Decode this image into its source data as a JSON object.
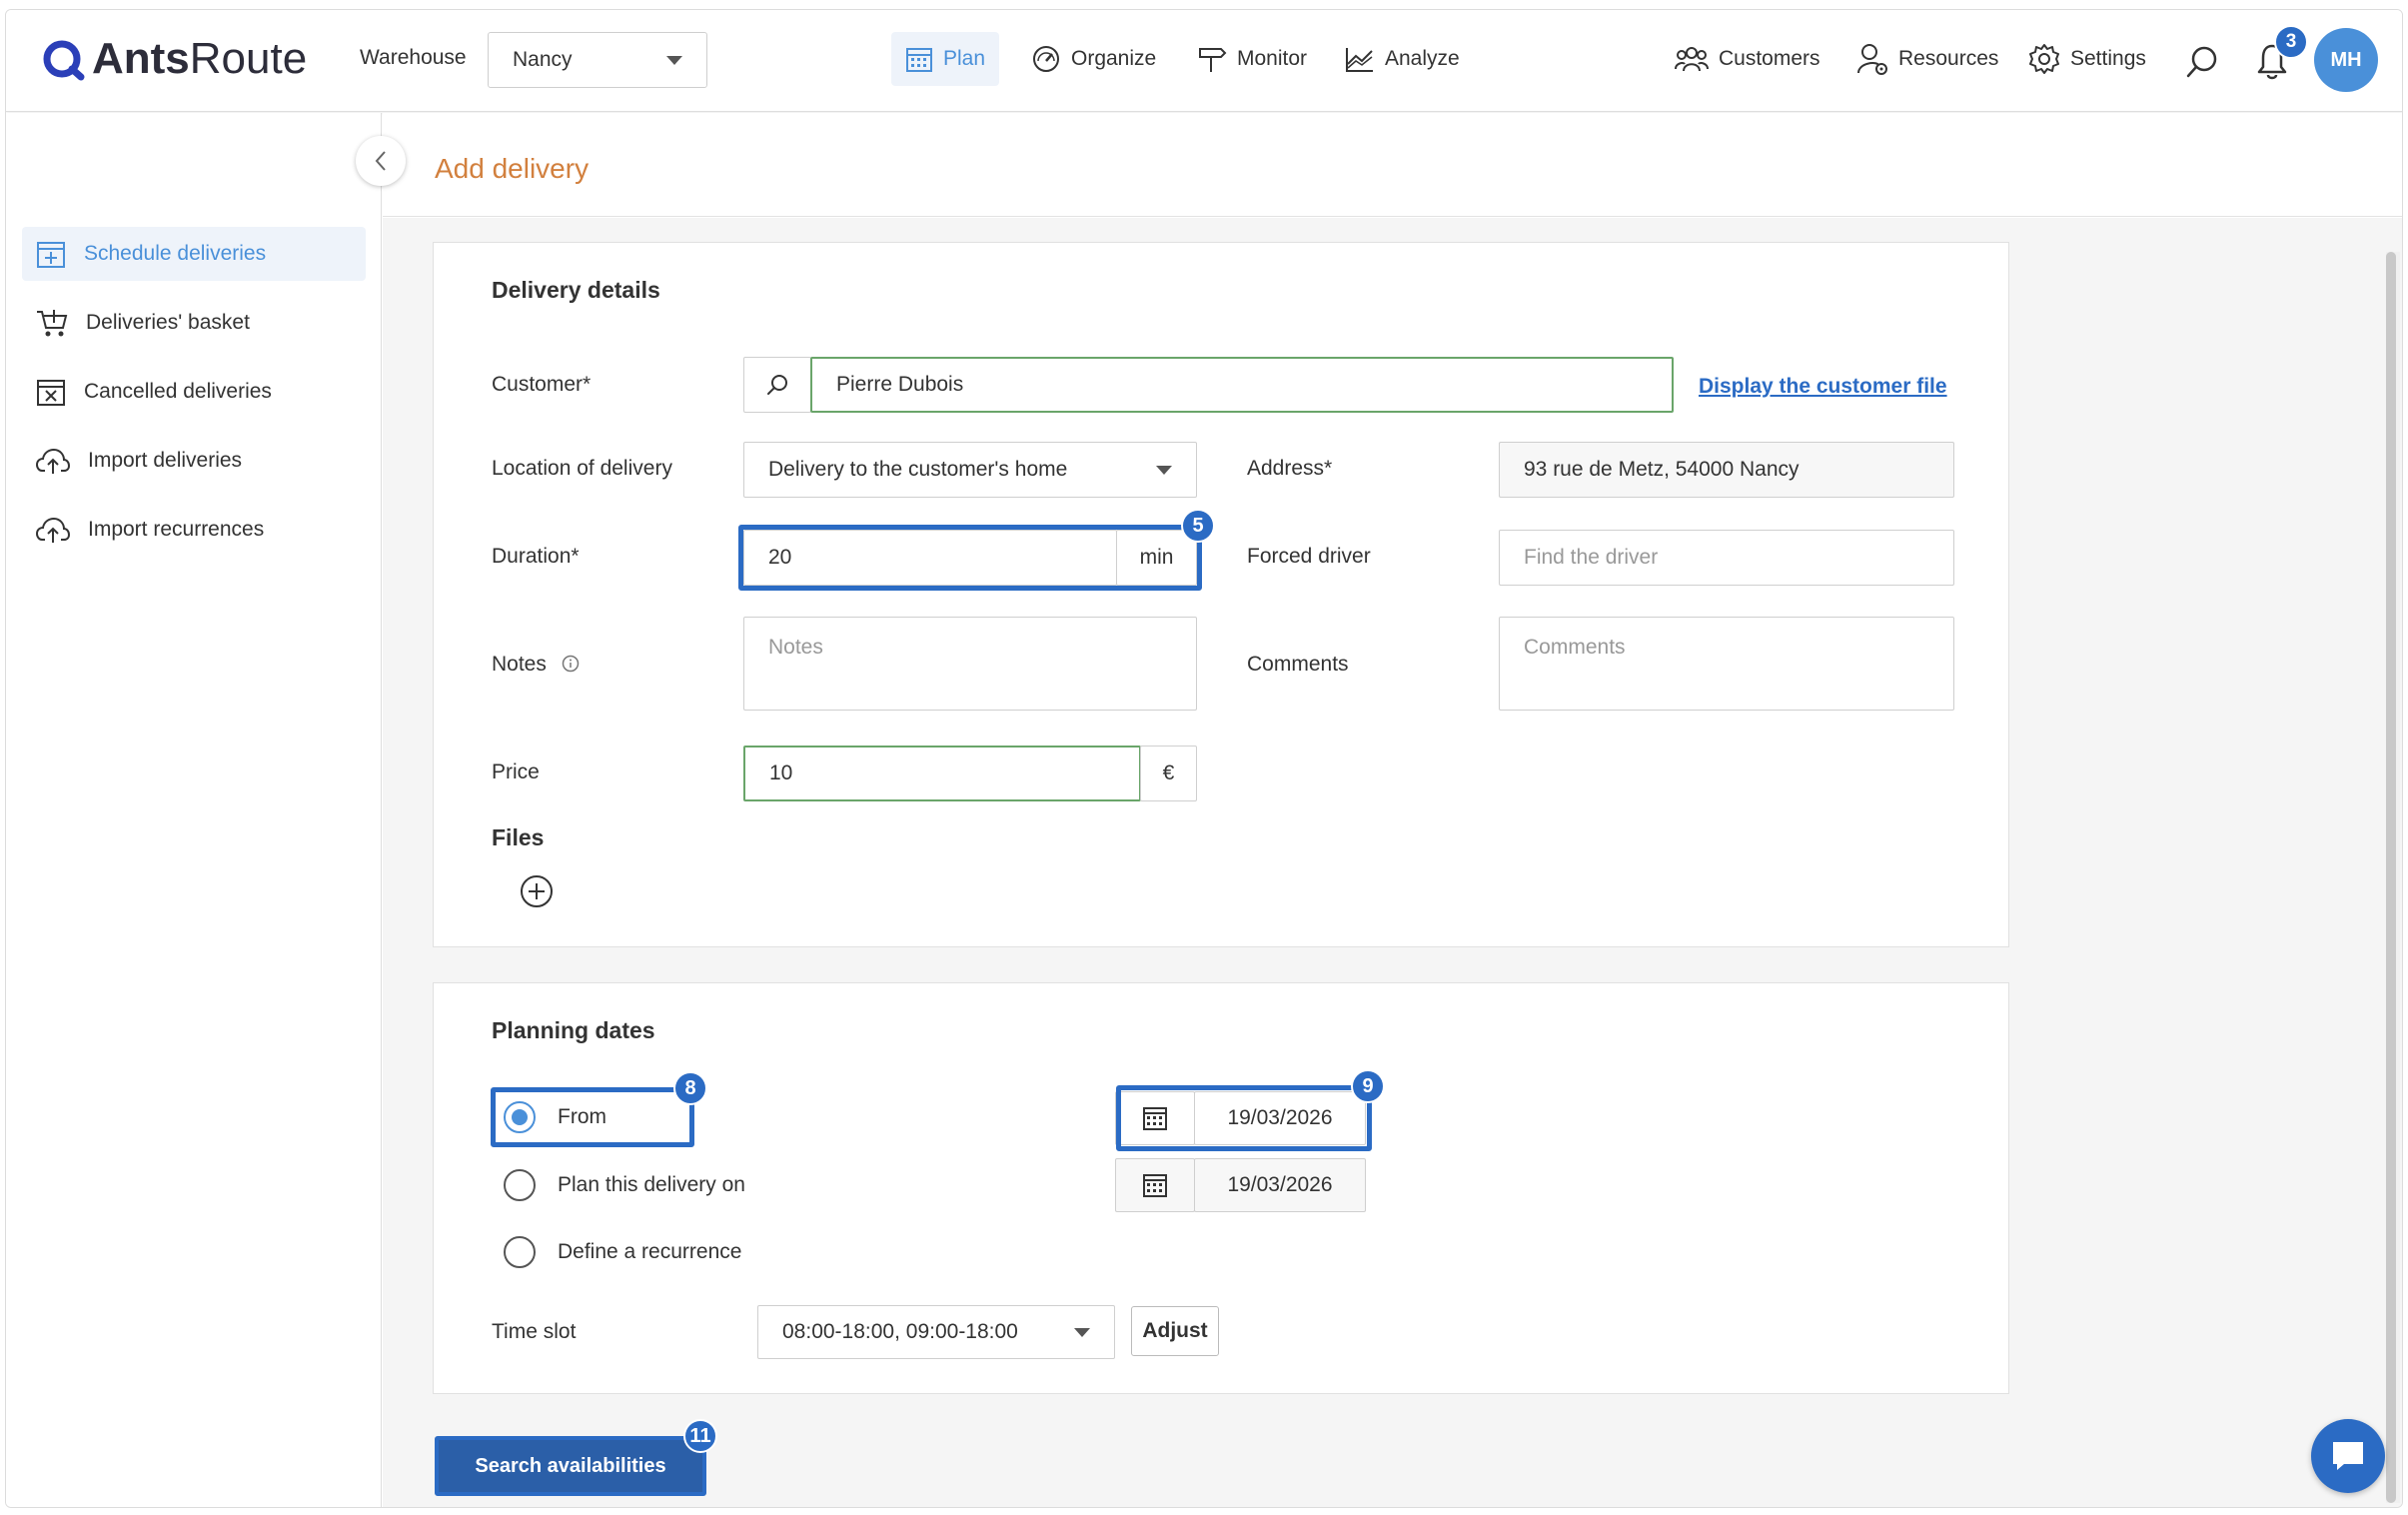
{
  "app": {
    "logo_bold": "Ants",
    "logo_rest": "Route"
  },
  "topbar": {
    "warehouse_label": "Warehouse",
    "warehouse_value": "Nancy",
    "nav": [
      {
        "label": "Plan",
        "icon": "calendar-icon",
        "active": true
      },
      {
        "label": "Organize",
        "icon": "gauge-icon"
      },
      {
        "label": "Monitor",
        "icon": "signpost-icon"
      },
      {
        "label": "Analyze",
        "icon": "chart-icon"
      }
    ],
    "right": [
      {
        "label": "Customers",
        "icon": "customers-icon"
      },
      {
        "label": "Resources",
        "icon": "resources-icon"
      },
      {
        "label": "Settings",
        "icon": "gear-icon"
      }
    ],
    "notifications": "3",
    "avatar": "MH"
  },
  "sidebar": {
    "items": [
      {
        "label": "Schedule deliveries",
        "icon": "calendar-plus-icon",
        "active": true
      },
      {
        "label": "Deliveries' basket",
        "icon": "basket-icon"
      },
      {
        "label": "Cancelled deliveries",
        "icon": "calendar-x-icon"
      },
      {
        "label": "Import deliveries",
        "icon": "cloud-upload-icon"
      },
      {
        "label": "Import recurrences",
        "icon": "cloud-upload-icon"
      }
    ]
  },
  "page": {
    "title": "Add delivery"
  },
  "delivery": {
    "title": "Delivery details",
    "customer_label": "Customer*",
    "customer_value": "Pierre Dubois",
    "customer_link": "Display the customer file",
    "location_label": "Location of delivery",
    "location_value": "Delivery to the customer's home",
    "address_label": "Address*",
    "address_value": "93 rue de Metz, 54000 Nancy",
    "duration_label": "Duration*",
    "duration_value": "20",
    "duration_unit": "min",
    "driver_label": "Forced driver",
    "driver_placeholder": "Find the driver",
    "notes_label": "Notes",
    "notes_placeholder": "Notes",
    "comments_label": "Comments",
    "comments_placeholder": "Comments",
    "price_label": "Price",
    "price_value": "10",
    "price_unit": "€",
    "files_label": "Files"
  },
  "planning": {
    "title": "Planning dates",
    "options": [
      {
        "label": "From",
        "selected": true,
        "date": "19/03/2026"
      },
      {
        "label": "Plan this delivery on",
        "selected": false,
        "date": "19/03/2026"
      },
      {
        "label": "Define a recurrence",
        "selected": false
      }
    ],
    "time_slot_label": "Time slot",
    "time_slot_value": "08:00-18:00, 09:00-18:00",
    "adjust_label": "Adjust"
  },
  "search_button": "Search availabilities",
  "badges": {
    "duration": "5",
    "from": "8",
    "date": "9",
    "search": "11"
  },
  "colors": {
    "accent": "#4a90d9",
    "highlight": "#2b6bc4",
    "title": "#d2803e",
    "valid": "#6aa56a"
  }
}
